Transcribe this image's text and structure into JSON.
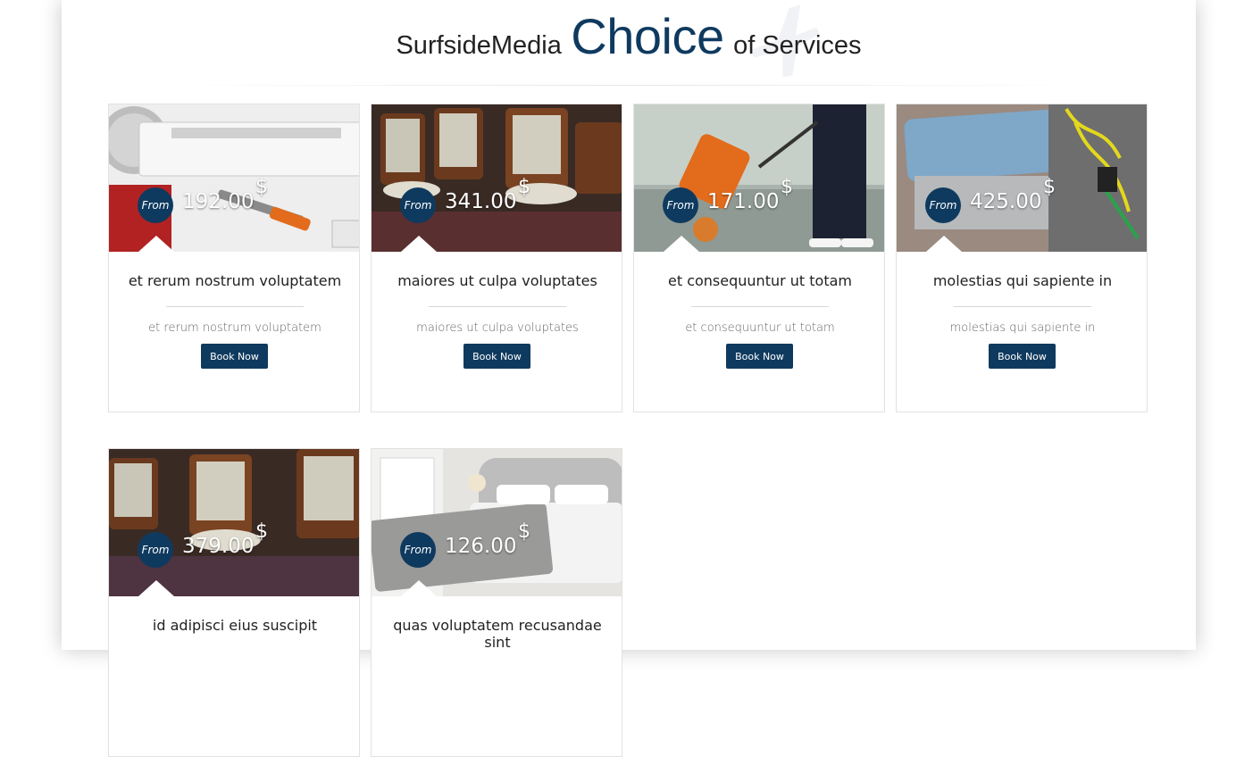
{
  "section": {
    "title_prefix": "SurfsideMedia",
    "title_highlight": "Choice",
    "title_suffix": "of Services"
  },
  "colors": {
    "brand_navy": "#0f3a5f"
  },
  "services": [
    {
      "title": "et rerum nostrum voluptatem",
      "subtitle": "et rerum nostrum voluptatem",
      "from_label": "From",
      "price": "192.00",
      "currency": "$",
      "button_label": "Book Now",
      "image": "air-conditioner-tools"
    },
    {
      "title": "maiores ut culpa voluptates",
      "subtitle": "maiores ut culpa voluptates",
      "from_label": "From",
      "price": "341.00",
      "currency": "$",
      "button_label": "Book Now",
      "image": "dining-chairs"
    },
    {
      "title": "et consequuntur ut totam",
      "subtitle": "et consequuntur ut totam",
      "from_label": "From",
      "price": "171.00",
      "currency": "$",
      "button_label": "Book Now",
      "image": "floor-cleaning"
    },
    {
      "title": "molestias qui sapiente in",
      "subtitle": "molestias qui sapiente in",
      "from_label": "From",
      "price": "425.00",
      "currency": "$",
      "button_label": "Book Now",
      "image": "ac-unit-repair"
    },
    {
      "title": "id adipisci eius suscipit",
      "subtitle": "",
      "from_label": "From",
      "price": "379.00",
      "currency": "$",
      "button_label": "",
      "image": "dining-chairs"
    },
    {
      "title": "quas voluptatem recusandae sint",
      "subtitle": "",
      "from_label": "From",
      "price": "126.00",
      "currency": "$",
      "button_label": "",
      "image": "bedroom"
    }
  ]
}
